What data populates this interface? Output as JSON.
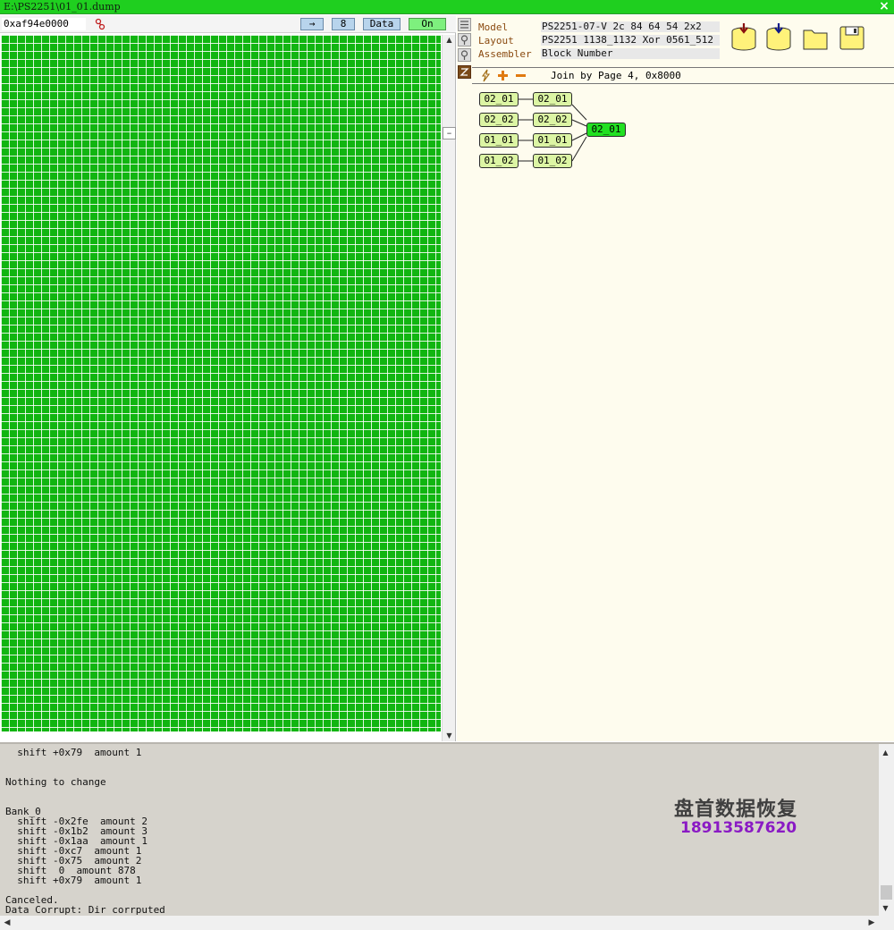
{
  "window": {
    "title": "E:\\PS2251\\01_01.dump"
  },
  "left_toolbar": {
    "address": "0xaf94e0000",
    "arrow_label": "→",
    "number_label": "8",
    "data_label": "Data",
    "on_label": "On"
  },
  "left_scroll": {
    "up": "▲",
    "down": "▼",
    "minus": "–"
  },
  "info": {
    "model_label": "Model",
    "model_value": "PS2251-07-V  2c 84 64 54  2x2",
    "layout_label": "Layout",
    "layout_value": "PS2251 1138_1132 Xor 0561_512",
    "assembler_label": "Assembler",
    "assembler_value": "Block Number"
  },
  "join_bar": {
    "text": "Join by Page 4, 0x8000"
  },
  "join_graph": {
    "nodes_left": [
      "02_01",
      "02_02",
      "01_01",
      "01_02"
    ],
    "nodes_mid": [
      "02_01",
      "02_02",
      "01_01",
      "01_02"
    ],
    "merged": "02_01"
  },
  "log": {
    "text": "  shift +0x79  amount 1\n\n\nNothing to change\n\n\nBank_0\n  shift -0x2fe  amount 2\n  shift -0x1b2  amount 3\n  shift -0x1aa  amount 1\n  shift -0xc7  amount 1\n  shift -0x75  amount 2\n  shift  0  amount 878\n  shift +0x79  amount 1\n\nCanceled.\nData Corrupt: Dir corrputed"
  },
  "watermark": {
    "title": "盘首数据恢复",
    "phone": "18913587620"
  },
  "colors": {
    "title_bar": "#1fcf1f",
    "grid": "#11b511",
    "panel_bg": "#fefcee",
    "node": "#dcf5a4",
    "merged_node": "#22e022"
  }
}
